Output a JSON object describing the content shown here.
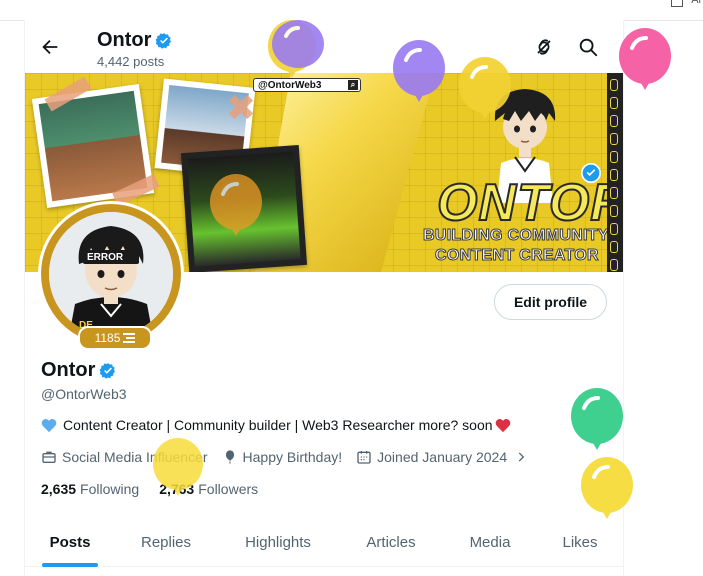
{
  "browser": {
    "extension_text": "Ai"
  },
  "header": {
    "name": "Ontor",
    "posts_count": "4,442 posts"
  },
  "banner": {
    "handle_bar": "@OntorWeb3",
    "big_title": "ONTOR",
    "subtitle_1": "BUILDING COMMUNITY",
    "subtitle_2": "CONTENT CREATOR"
  },
  "avatar": {
    "badge_value": "1185",
    "shirt_text": "ERROR"
  },
  "profile": {
    "edit_label": "Edit profile",
    "name": "Ontor",
    "handle": "@OntorWeb3",
    "bio": "Content Creator | Community builder | Web3 Researcher more? soon",
    "meta": {
      "category": "Social Media Influencer",
      "birthday": "Happy Birthday!",
      "joined": "Joined January 2024"
    },
    "following_count": "2,635",
    "following_label": "Following",
    "followers_count": "2,763",
    "followers_label": "Followers"
  },
  "tabs": [
    "Posts",
    "Replies",
    "Highlights",
    "Articles",
    "Media",
    "Likes"
  ],
  "active_tab": "Posts",
  "colors": {
    "accent": "#1d9bf0",
    "gold": "#c8951f",
    "banner_yellow": "#e9c926",
    "text_primary": "#0f1419",
    "text_secondary": "#536471"
  },
  "icons": {
    "back": "arrow-left-icon",
    "verified": "verified-badge-icon",
    "grok": "grok-icon",
    "search": "search-icon",
    "category": "briefcase-icon",
    "birthday": "balloon-icon",
    "calendar": "calendar-icon",
    "chevron": "chevron-right-icon"
  }
}
